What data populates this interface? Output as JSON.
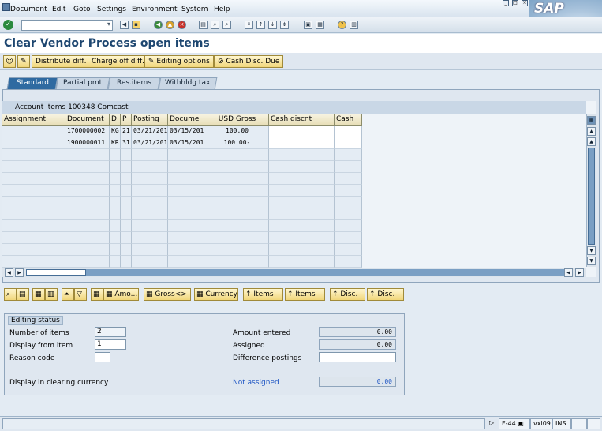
{
  "menu": {
    "items": [
      "Document",
      "Edit",
      "Goto",
      "Settings",
      "Environment",
      "System",
      "Help"
    ]
  },
  "logo": "SAP",
  "page": {
    "title": "Clear Vendor Process open items"
  },
  "app_toolbar": {
    "distribute": "Distribute diff.",
    "charge_off": "Charge off diff.",
    "editing_options": "Editing options",
    "cash_disc_due": "Cash Disc. Due"
  },
  "tabs": {
    "standard": "Standard",
    "partial_pmt": "Partial pmt",
    "res_items": "Res.items",
    "withhldg_tax": "Withhldg tax"
  },
  "table": {
    "title": "Account items 100348 Comcast",
    "columns": [
      "Assignment",
      "Document",
      "D",
      "P",
      "Posting",
      "Docume",
      "USD Gross",
      "Cash discnt",
      "Cash"
    ],
    "rows": [
      [
        "",
        "1700000002",
        "KG",
        "21",
        "03/21/201",
        "03/15/201",
        "100.00",
        "",
        ""
      ],
      [
        "",
        "1900000011",
        "KR",
        "31",
        "03/21/201",
        "03/15/201",
        "100.00-",
        "",
        ""
      ]
    ]
  },
  "bottom_toolbar": {
    "amount": "Amo...",
    "gross": "Gross<>",
    "currency": "Currency",
    "items1": "Items",
    "items2": "Items",
    "disc1": "Disc.",
    "disc2": "Disc."
  },
  "editing_status": {
    "title": "Editing status",
    "number_of_items_label": "Number of items",
    "number_of_items": "2",
    "display_from_item_label": "Display from item",
    "display_from_item": "1",
    "reason_code_label": "Reason code",
    "reason_code": "",
    "display_currency_label": "Display in clearing currency",
    "amount_entered_label": "Amount entered",
    "amount_entered": "0.00",
    "assigned_label": "Assigned",
    "assigned": "0.00",
    "difference_label": "Difference postings",
    "difference": "",
    "not_assigned_label": "Not assigned",
    "not_assigned": "0.00"
  },
  "status_bar": {
    "transaction": "F-44",
    "server": "vxl09",
    "mode": "INS"
  }
}
